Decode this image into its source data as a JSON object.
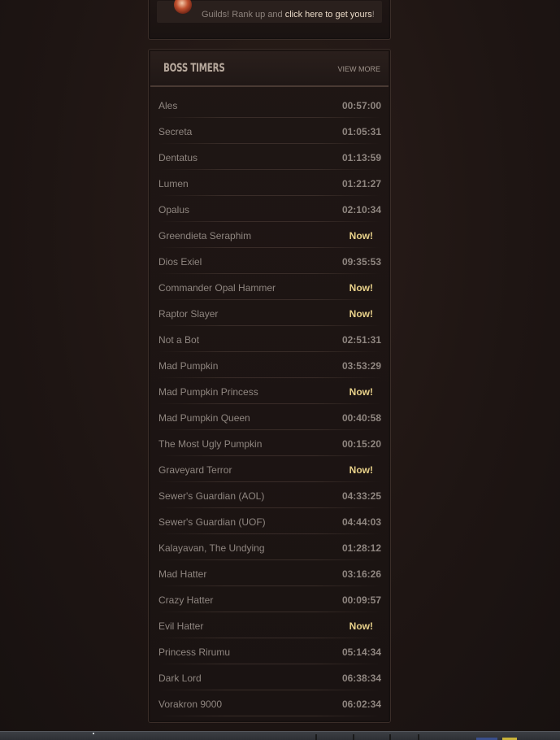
{
  "guild": {
    "text_before": "Guilds! Rank up and ",
    "link": "click here to get yours",
    "text_after": "!"
  },
  "boss_timers": {
    "title": "BOSS TIMERS",
    "view_more": "VIEW MORE",
    "rows": [
      {
        "name": "Ales",
        "time": "00:57:00"
      },
      {
        "name": "Secreta",
        "time": "01:05:31"
      },
      {
        "name": "Dentatus",
        "time": "01:13:59"
      },
      {
        "name": "Lumen",
        "time": "01:21:27"
      },
      {
        "name": "Opalus",
        "time": "02:10:34"
      },
      {
        "name": "Greendieta Seraphim",
        "time": "Now!"
      },
      {
        "name": "Dios Exiel",
        "time": "09:35:53"
      },
      {
        "name": "Commander Opal Hammer",
        "time": "Now!"
      },
      {
        "name": "Raptor Slayer",
        "time": "Now!"
      },
      {
        "name": "Not a Bot",
        "time": "02:51:31"
      },
      {
        "name": "Mad Pumpkin",
        "time": "03:53:29"
      },
      {
        "name": "Mad Pumpkin Princess",
        "time": "Now!"
      },
      {
        "name": "Mad Pumpkin Queen",
        "time": "00:40:58"
      },
      {
        "name": "The Most Ugly Pumpkin",
        "time": "00:15:20"
      },
      {
        "name": "Graveyard Terror",
        "time": "Now!"
      },
      {
        "name": "Sewer's Guardian (AOL)",
        "time": "04:33:25"
      },
      {
        "name": "Sewer's Guardian (UOF)",
        "time": "04:44:03"
      },
      {
        "name": "Kalayavan, The Undying",
        "time": "01:28:12"
      },
      {
        "name": "Mad Hatter",
        "time": "03:16:26"
      },
      {
        "name": "Crazy Hatter",
        "time": "00:09:57"
      },
      {
        "name": "Evil Hatter",
        "time": "Now!"
      },
      {
        "name": "Princess Rirumu",
        "time": "05:14:34"
      },
      {
        "name": "Dark Lord",
        "time": "06:38:34"
      },
      {
        "name": "Vorakron 9000",
        "time": "06:02:34"
      }
    ]
  },
  "colors": {
    "now_highlight": "#e8d18a",
    "text_muted": "#8f8680",
    "link": "#e9d9c7"
  }
}
